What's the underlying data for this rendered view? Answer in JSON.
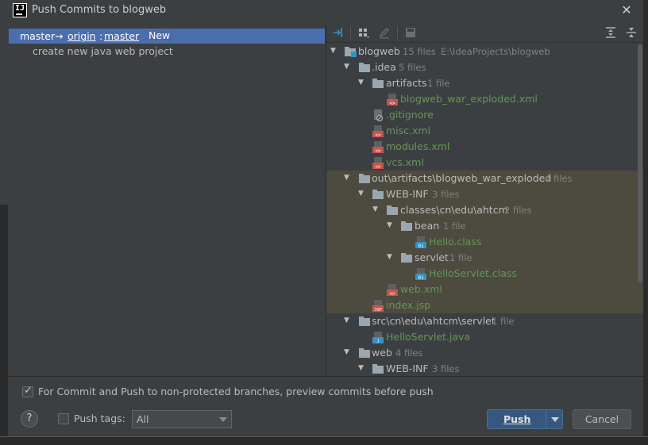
{
  "window": {
    "title": "Push Commits to blogweb"
  },
  "left": {
    "branch": {
      "local": "master",
      "arrow": "→",
      "remote": "origin",
      "colon": ":",
      "target": "master",
      "badge": "New"
    },
    "commit": "create new java web project"
  },
  "toolbar": {
    "icons": [
      "expand-all-icon",
      "group-by-icon",
      "edit-icon",
      "save-icon",
      "expand-icon",
      "collapse-icon"
    ]
  },
  "tree": [
    {
      "name": "blogweb",
      "count": "15 files",
      "extra": "E:\\IdeaProjects\\blogweb"
    },
    {
      "name": ".idea",
      "count": "5 files"
    },
    {
      "name": "artifacts",
      "count": "1 file"
    },
    {
      "name": "blogweb_war_exploded.xml"
    },
    {
      "name": ".gitignore"
    },
    {
      "name": "misc.xml"
    },
    {
      "name": "modules.xml"
    },
    {
      "name": "vcs.xml"
    },
    {
      "name": "out\\artifacts\\blogweb_war_exploded",
      "count": "4 files"
    },
    {
      "name": "WEB-INF",
      "count": "3 files"
    },
    {
      "name": "classes\\cn\\edu\\ahtcm",
      "count": "2 files"
    },
    {
      "name": "bean",
      "count": "1 file"
    },
    {
      "name": "Hello.class"
    },
    {
      "name": "servlet",
      "count": "1 file"
    },
    {
      "name": "HelloServlet.class"
    },
    {
      "name": "web.xml"
    },
    {
      "name": "index.jsp"
    },
    {
      "name": "src\\cn\\edu\\ahtcm\\servlet",
      "count": "1 file"
    },
    {
      "name": "HelloServlet.java"
    },
    {
      "name": "web",
      "count": "4 files"
    },
    {
      "name": "WEB-INF",
      "count": "3 files"
    }
  ],
  "bottom": {
    "preview_label": "For Commit and Push to non-protected branches, preview commits before push",
    "help": "?",
    "push_tags_label": "Push tags:",
    "tags_value": "All",
    "push_label": "Push",
    "cancel_label": "Cancel"
  },
  "colors": {
    "selection": "#4b6eaf",
    "modified": "#629755",
    "highlight": "#4d4a3f",
    "primary_button": "#365880"
  }
}
